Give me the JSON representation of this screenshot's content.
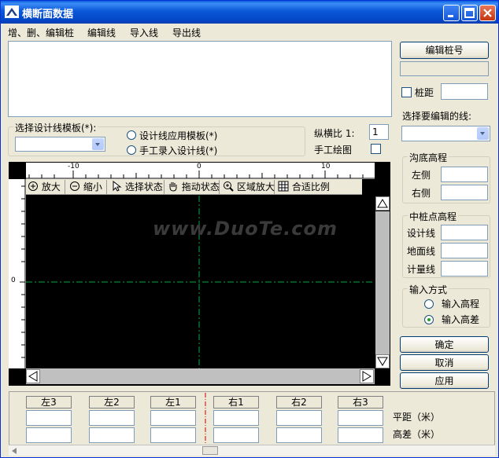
{
  "window": {
    "title": "横断面数据"
  },
  "menu": [
    "增、删、编辑桩",
    "编辑线",
    "导入线",
    "导出线"
  ],
  "right_panel": {
    "edit_pile_button": "编辑桩号",
    "pile_distance_label": "桩距",
    "select_line_label": "选择要编辑的线:",
    "ditch_group": {
      "title": "沟底高程",
      "left": "左侧",
      "right": "右侧"
    },
    "center_group": {
      "title": "中桩点高程",
      "design": "设计线",
      "ground": "地面线",
      "measure": "计量线"
    },
    "input_group": {
      "title": "输入方式",
      "option1": "输入高程",
      "option2": "输入高差",
      "selected": 2
    },
    "confirm_button": "确定",
    "cancel_button": "取消",
    "apply_button": "应用"
  },
  "template_group": {
    "title": "选择设计线模板(*):",
    "radio1": "设计线应用模板(*)",
    "radio2": "手工录入设计线(*)"
  },
  "ratio": {
    "label": "纵横比 1:",
    "value": "1",
    "hand_draw_label": "手工绘图"
  },
  "ruler": {
    "labels": [
      "-10",
      "0",
      "10"
    ],
    "vertical_label": "0"
  },
  "plot_toolbar": [
    "放大",
    "缩小",
    "选择状态",
    "拖动状态",
    "区域放大",
    "合适比例"
  ],
  "watermark": "www.DuoTe.com",
  "bottom_table": {
    "columns": [
      "左3",
      "左2",
      "左1",
      "右1",
      "右2",
      "右3"
    ],
    "row_labels": [
      "平距（米）",
      "高差（米）"
    ]
  },
  "colors": {
    "title_bar": "#0a58d8",
    "plot_bg": "#000000",
    "axis_line": "#00aa44"
  }
}
